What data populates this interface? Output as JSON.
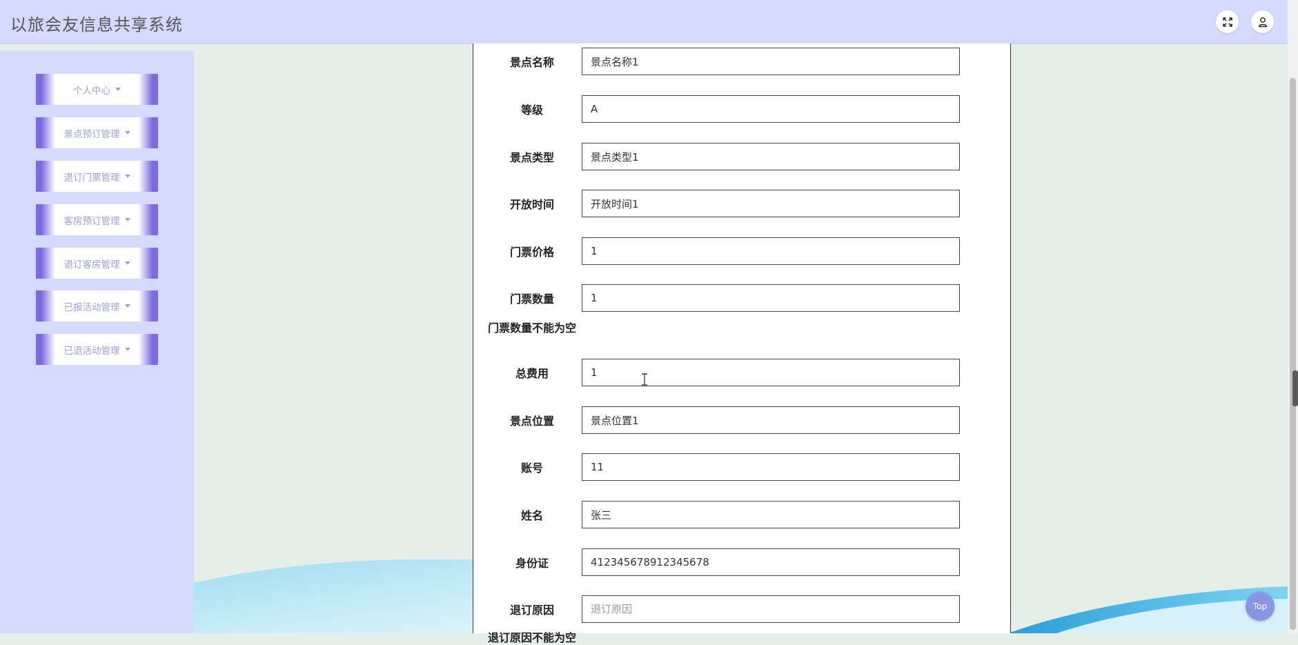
{
  "header": {
    "title": "以旅会友信息共享系统",
    "fullscreen_icon": "fullscreen-icon",
    "user_icon": "user-icon"
  },
  "sidebar": {
    "items": [
      {
        "label": "个人中心"
      },
      {
        "label": "景点预订管理"
      },
      {
        "label": "退订门票管理"
      },
      {
        "label": "客房预订管理"
      },
      {
        "label": "退订客房管理"
      },
      {
        "label": "已报活动管理"
      },
      {
        "label": "已退活动管理"
      }
    ]
  },
  "form": {
    "fields": [
      {
        "label": "景点名称",
        "value": "景点名称1",
        "placeholder": ""
      },
      {
        "label": "等级",
        "value": "A",
        "placeholder": ""
      },
      {
        "label": "景点类型",
        "value": "景点类型1",
        "placeholder": ""
      },
      {
        "label": "开放时间",
        "value": "开放时间1",
        "placeholder": ""
      },
      {
        "label": "门票价格",
        "value": "1",
        "placeholder": ""
      },
      {
        "label": "门票数量",
        "value": "1",
        "placeholder": ""
      },
      {
        "label": "总费用",
        "value": "1",
        "placeholder": ""
      },
      {
        "label": "景点位置",
        "value": "景点位置1",
        "placeholder": ""
      },
      {
        "label": "账号",
        "value": "11",
        "placeholder": ""
      },
      {
        "label": "姓名",
        "value": "张三",
        "placeholder": ""
      },
      {
        "label": "身份证",
        "value": "412345678912345678",
        "placeholder": ""
      },
      {
        "label": "退订原因",
        "value": "",
        "placeholder": "退订原因"
      }
    ],
    "ticket_qty_error": "门票数量不能为空",
    "reason_error": "退订原因不能为空"
  },
  "top_button": "Top",
  "colors": {
    "header_bg": "#d4d9ff",
    "sidebar_bg": "#d4d9ff",
    "menu_accent": "#7c6be0",
    "page_bg": "#e6eeea",
    "top_button_bg": "#8a95e6"
  }
}
